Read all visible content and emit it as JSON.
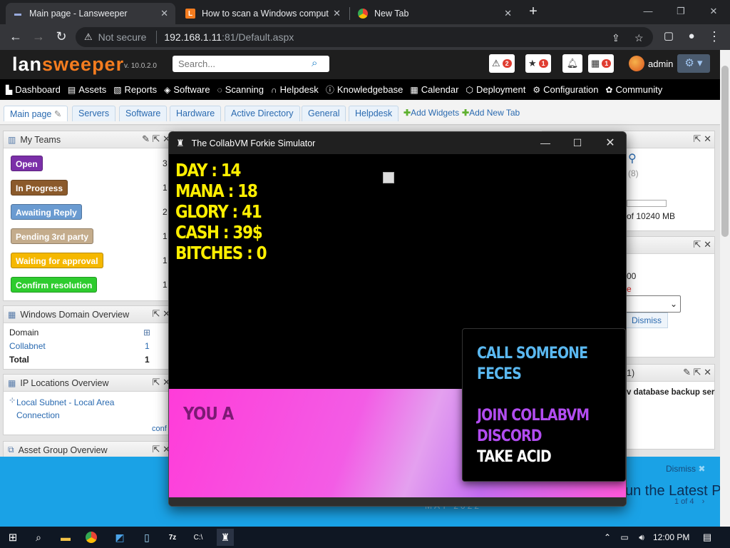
{
  "browser": {
    "tabs": [
      {
        "title": "Main page - Lansweeper",
        "active": true
      },
      {
        "title": "How to scan a Windows compute",
        "active": false
      },
      {
        "title": "New Tab",
        "active": false
      }
    ],
    "new_tab_symbol": "+",
    "security_label": "Not secure",
    "url_host": "192.168.1.11",
    "url_rest": ":81/Default.aspx"
  },
  "lansweeper": {
    "logo_part1": "lan",
    "logo_part2": "sweeper",
    "version": "v. 10.0.2.0",
    "search_placeholder": "Search...",
    "alerts_count": "2",
    "favorites_count": "1",
    "calendar_count": "1",
    "user": "admin",
    "nav": [
      "Dashboard",
      "Assets",
      "Reports",
      "Software",
      "Scanning",
      "Helpdesk",
      "Knowledgebase",
      "Calendar",
      "Deployment",
      "Configuration",
      "Community"
    ],
    "content_tabs": [
      "Main page",
      "Servers",
      "Software",
      "Hardware",
      "Active Directory",
      "General",
      "Helpdesk"
    ],
    "add_widgets": "Add Widgets",
    "add_new_tab": "Add New Tab"
  },
  "widgets": {
    "my_teams": {
      "title": "My Teams",
      "rows": [
        {
          "label": "Open",
          "count": "3",
          "color": "#7b2fa8"
        },
        {
          "label": "In Progress",
          "count": "1",
          "color": "#8b5a2b"
        },
        {
          "label": "Awaiting Reply",
          "count": "2",
          "color": "#6a9bd1"
        },
        {
          "label": "Pending 3rd party",
          "count": "1",
          "color": "#c4ac8c"
        },
        {
          "label": "Waiting for approval",
          "count": "1",
          "color": "#f5b800"
        },
        {
          "label": "Confirm resolution",
          "count": "1",
          "color": "#2ecc2e"
        }
      ]
    },
    "domain_overview": {
      "title": "Windows Domain Overview",
      "col_domain": "Domain",
      "row_domain": "Collabnet",
      "row_count": "1",
      "total_label": "Total",
      "total_count": "1"
    },
    "ip_locations": {
      "title": "IP Locations Overview",
      "item_line1": "Local Subnet - Local Area",
      "item_line2": "Connection",
      "footer": "conf"
    },
    "asset_group": {
      "title": "Asset Group Overview"
    },
    "right_partial": {
      "count_8": "(8)",
      "storage_text": "of 10240 MB",
      "num_00": "00",
      "red_e": "e",
      "dismiss": "Dismiss",
      "paren_1": "1)",
      "backup_text": "v database backup ser"
    }
  },
  "banner": {
    "dismiss": "Dismiss",
    "title": "un the Latest P",
    "page": "1 of 4",
    "date": "MAY 2022"
  },
  "game": {
    "window_title": "The CollabVM Forkie Simulator",
    "stats": [
      {
        "label": "DAY : 14"
      },
      {
        "label": "MANA : 18"
      },
      {
        "label": "GLORY : 41"
      },
      {
        "label": "CASH : 39$"
      },
      {
        "label": "BITCHES : 0"
      }
    ],
    "dialog": "YOU A",
    "menu": [
      {
        "label": "CALL SOMEONE",
        "color": "#5ab8f0"
      },
      {
        "label": "FECES",
        "color": "#5ab8f0"
      },
      {
        "label": "JOIN COLLABVM",
        "color": "#b24cf0"
      },
      {
        "label": "DISCORD",
        "color": "#b24cf0"
      },
      {
        "label": "TAKE ACID",
        "color": "#ffffff"
      }
    ]
  },
  "taskbar": {
    "time": "12:00 PM"
  }
}
